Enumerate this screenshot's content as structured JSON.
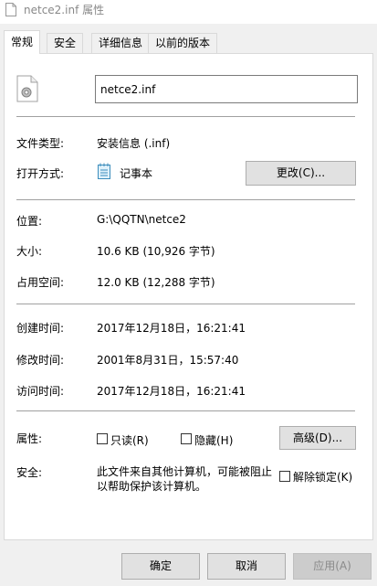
{
  "window": {
    "title": "netce2.inf 属性"
  },
  "tabs": [
    {
      "label": "常规",
      "active": true
    },
    {
      "label": "安全",
      "active": false
    },
    {
      "label": "详细信息",
      "active": false
    },
    {
      "label": "以前的版本",
      "active": false
    }
  ],
  "general": {
    "filename": "netce2.inf",
    "file_type_label": "文件类型:",
    "file_type_value": "安装信息 (.inf)",
    "opens_with_label": "打开方式:",
    "opens_with_value": "记事本",
    "change_button": "更改(C)...",
    "location_label": "位置:",
    "location_value": "G:\\QQTN\\netce2",
    "size_label": "大小:",
    "size_value": "10.6 KB (10,926 字节)",
    "size_on_disk_label": "占用空间:",
    "size_on_disk_value": "12.0 KB (12,288 字节)",
    "created_label": "创建时间:",
    "created_value": "2017年12月18日，16:21:41",
    "modified_label": "修改时间:",
    "modified_value": "2001年8月31日，15:57:40",
    "accessed_label": "访问时间:",
    "accessed_value": "2017年12月18日，16:21:41",
    "attributes_label": "属性:",
    "readonly_label": "只读(R)",
    "hidden_label": "隐藏(H)",
    "advanced_button": "高级(D)...",
    "security_label": "安全:",
    "security_text_line1": "此文件来自其他计算机，可能被阻止",
    "security_text_line2": "以帮助保护该计算机。",
    "unblock_label": "解除锁定(K)"
  },
  "footer": {
    "ok": "确定",
    "cancel": "取消",
    "apply": "应用(A)"
  },
  "colors": {
    "dialog_bg": "#f0f0f0",
    "panel_bg": "#ffffff",
    "title_text": "#888888"
  },
  "icons": [
    "file-settings-icon",
    "notepad-icon"
  ]
}
